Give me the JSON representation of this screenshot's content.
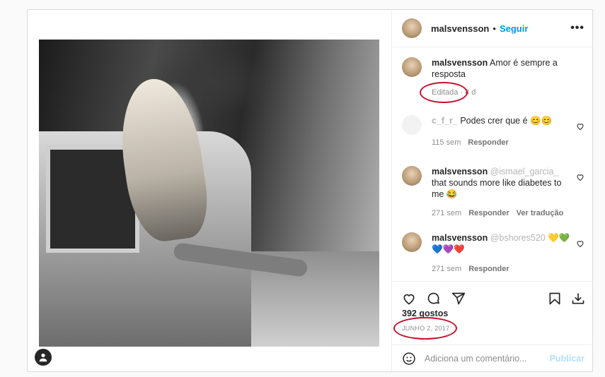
{
  "post": {
    "username": "malsvensson",
    "separator": "•",
    "follow_label": "Seguir",
    "more_icon": "more-options-icon",
    "caption": {
      "username": "malsvensson",
      "text": "Amor é sempre a resposta",
      "meta": "Editada · 4 d"
    },
    "comments": [
      {
        "username": "c_f_r_",
        "text": "Podes crer que é 😊😊",
        "time": "115 sem",
        "reply": "Responder",
        "translate": ""
      },
      {
        "username": "malsvensson",
        "mention": "@ismael_garcia_",
        "text": "that sounds more like diabetes to me 😂",
        "time": "271 sem",
        "reply": "Responder",
        "translate": "Ver tradução"
      },
      {
        "username": "malsvensson",
        "mention": "@bshores520",
        "text": "💛💚💙💜❤️",
        "time": "271 sem",
        "reply": "Responder",
        "translate": ""
      }
    ],
    "likes": "392 gostos",
    "date": "JUNHO 2, 2017",
    "add_comment_placeholder": "Adiciona um comentário...",
    "publish_label": "Publicar"
  },
  "colors": {
    "accent": "#0095f6",
    "highlight_ring": "#c8102e"
  }
}
